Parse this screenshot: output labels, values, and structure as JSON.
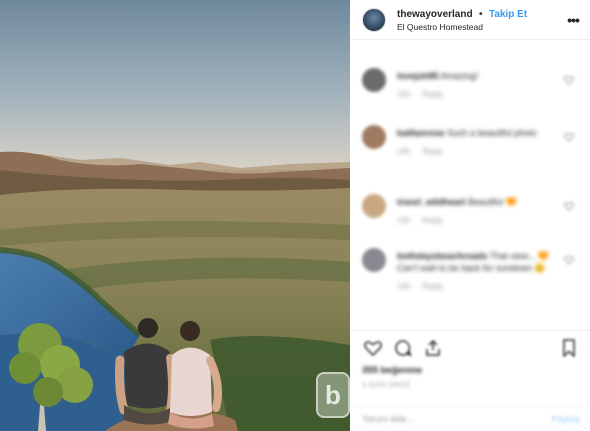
{
  "post": {
    "username": "thewayoverland",
    "separator": "•",
    "follow_label": "Takip Et",
    "location": "El Questro Homestead",
    "more_label": "•••"
  },
  "comments": [
    {
      "username": "lovejoh85",
      "text": "Amazing!",
      "time": "15h",
      "reply_label": "Reply",
      "avatar_color": "#6b6b6b"
    },
    {
      "username": "kaitlanrose",
      "text": "Such a beautiful photo",
      "time": "14h",
      "reply_label": "Reply",
      "avatar_color": "#a07a60"
    },
    {
      "username": "travel_wildheart",
      "text": "Beautiful 🧡",
      "time": "12h",
      "reply_label": "Reply",
      "avatar_color": "#c8a883"
    },
    {
      "username": "bothdaysbeachroads",
      "text": "That view... 🧡 Can't wait to be back for sundown 😊",
      "time": "10h",
      "reply_label": "Reply",
      "avatar_color": "#8a8890"
    }
  ],
  "engagement": {
    "likes": "355 beğenme",
    "date": "3 GÜN ÖNCE"
  },
  "compose": {
    "placeholder": "Yorum ekle...",
    "post_label": "Paylaş"
  },
  "watermark": "b",
  "colors": {
    "follow_blue": "#3897f0",
    "post_disabled": "#b3dbff",
    "border": "#efefef",
    "meta_gray": "#999999"
  }
}
